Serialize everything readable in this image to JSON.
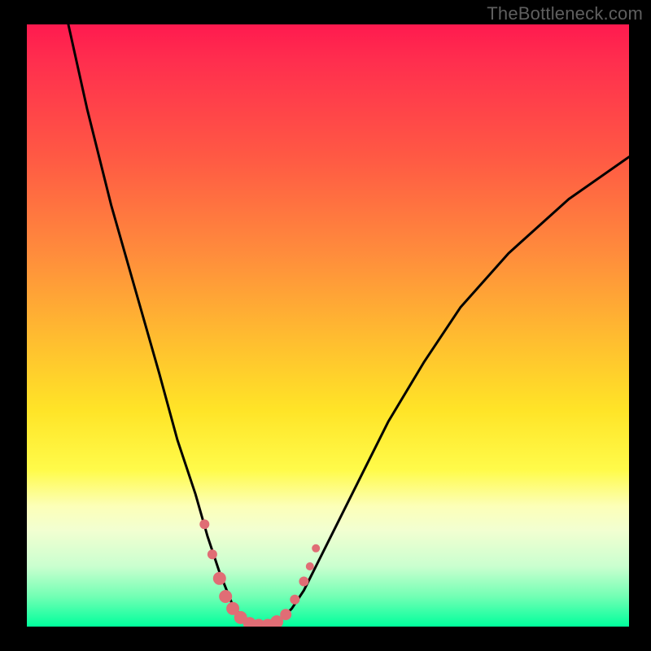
{
  "watermark": "TheBottleneck.com",
  "colors": {
    "frame": "#000000",
    "curve": "#000000",
    "marker_fill": "#e06d75",
    "marker_stroke": "#d85a63"
  },
  "chart_data": {
    "type": "line",
    "title": "",
    "xlabel": "",
    "ylabel": "",
    "xlim": [
      0,
      100
    ],
    "ylim": [
      0,
      100
    ],
    "grid": false,
    "legend": false,
    "note": "Bottleneck curve: y = bottleneck percentage (0 at minimum). Values estimated from rendered gradient position; minimum plateau around x≈35–42.",
    "series": [
      {
        "name": "bottleneck_curve",
        "x": [
          0,
          3,
          6,
          10,
          14,
          18,
          22,
          25,
          28,
          30,
          32,
          34,
          36,
          38,
          40,
          42,
          44,
          46,
          48,
          52,
          56,
          60,
          66,
          72,
          80,
          90,
          100
        ],
        "y": [
          140,
          120,
          104,
          86,
          70,
          56,
          42,
          31,
          22,
          15,
          9,
          4,
          1,
          0,
          0,
          1,
          3,
          6,
          10,
          18,
          26,
          34,
          44,
          53,
          62,
          71,
          78
        ]
      }
    ],
    "markers": [
      {
        "x": 29.5,
        "y": 17,
        "r": 6
      },
      {
        "x": 30.8,
        "y": 12,
        "r": 6
      },
      {
        "x": 32.0,
        "y": 8,
        "r": 8
      },
      {
        "x": 33.0,
        "y": 5,
        "r": 8
      },
      {
        "x": 34.2,
        "y": 3,
        "r": 8
      },
      {
        "x": 35.5,
        "y": 1.5,
        "r": 8
      },
      {
        "x": 37.0,
        "y": 0.5,
        "r": 8
      },
      {
        "x": 38.5,
        "y": 0.2,
        "r": 8
      },
      {
        "x": 40.0,
        "y": 0.2,
        "r": 8
      },
      {
        "x": 41.5,
        "y": 0.8,
        "r": 8
      },
      {
        "x": 43.0,
        "y": 2.0,
        "r": 7
      },
      {
        "x": 44.5,
        "y": 4.5,
        "r": 6
      },
      {
        "x": 46.0,
        "y": 7.5,
        "r": 6
      },
      {
        "x": 47.0,
        "y": 10,
        "r": 5
      },
      {
        "x": 48.0,
        "y": 13,
        "r": 5
      }
    ]
  }
}
